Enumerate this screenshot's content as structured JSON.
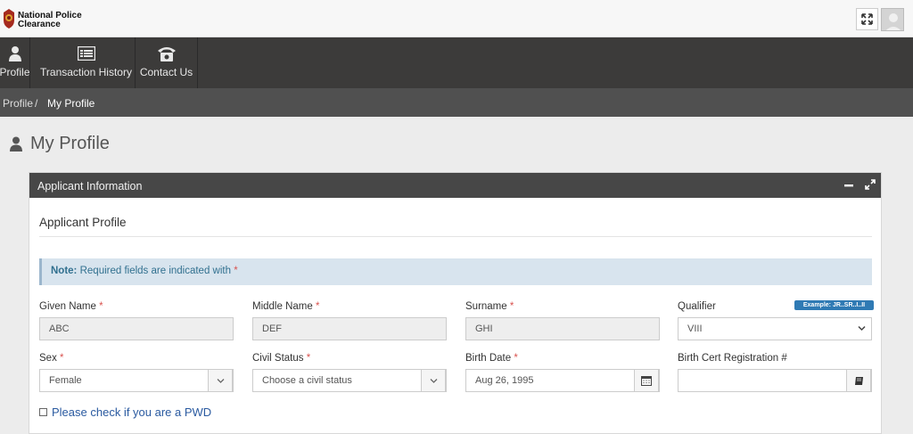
{
  "header": {
    "brand_line1": "National Police",
    "brand_line2": "Clearance"
  },
  "nav": {
    "items": [
      {
        "label": "Profile",
        "icon": "user-icon"
      },
      {
        "label": "Transaction History",
        "icon": "list-icon"
      },
      {
        "label": "Contact Us",
        "icon": "phone-icon"
      }
    ]
  },
  "breadcrumb": {
    "parent": "Profile",
    "separator": "/",
    "current": "My Profile"
  },
  "page": {
    "title": "My Profile"
  },
  "panel": {
    "title": "Applicant Information",
    "section_title": "Applicant Profile",
    "note_prefix": "Note:",
    "note_text": "Required fields are indicated with",
    "required_mark": "*"
  },
  "form": {
    "given_name": {
      "label": "Given Name",
      "value": "ABC"
    },
    "middle_name": {
      "label": "Middle Name",
      "value": "DEF"
    },
    "surname": {
      "label": "Surname",
      "value": "GHI"
    },
    "qualifier": {
      "label": "Qualifier",
      "value": "VIII",
      "hint": "Example: JR..SR..I..II"
    },
    "sex": {
      "label": "Sex",
      "value": "Female"
    },
    "civil_status": {
      "label": "Civil Status",
      "value": "Choose a civil status"
    },
    "birth_date": {
      "label": "Birth Date",
      "value": "Aug 26, 1995"
    },
    "birth_cert": {
      "label": "Birth Cert Registration #",
      "value": ""
    },
    "pwd": {
      "label": "Please check if you are a PWD",
      "checked": false
    }
  },
  "colors": {
    "navbar": "#3c3b3a",
    "breadcrumb_bar": "#505050",
    "panel_header": "#474747",
    "note_bg": "#d8e4ee",
    "badge": "#2f7ab4",
    "required": "#d9534f"
  }
}
